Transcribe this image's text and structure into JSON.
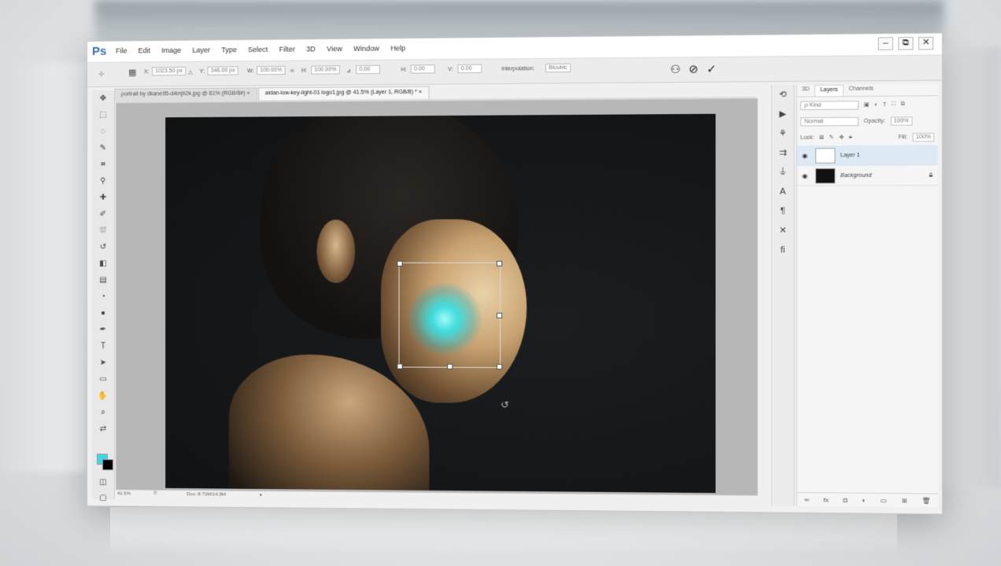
{
  "app": {
    "logo": "Ps"
  },
  "menu": [
    "File",
    "Edit",
    "Image",
    "Layer",
    "Type",
    "Select",
    "Filter",
    "3D",
    "View",
    "Window",
    "Help"
  ],
  "window_controls": [
    "–",
    "⧉",
    "✕"
  ],
  "options": {
    "x_label": "X:",
    "x_value": "1023.50 px",
    "y_label": "Y:",
    "y_value": "346.00 px",
    "w_label": "W:",
    "w_value": "100.00%",
    "h_label": "H:",
    "h_value": "100.00%",
    "angle_value": "0.00",
    "hskew_label": "H:",
    "hskew_value": "0.00",
    "vskew_label": "V:",
    "vskew_value": "0.00",
    "interp_label": "Interpolation:",
    "interp_value": "Bicubic"
  },
  "tabs": [
    {
      "label": "portrait by dkane95-d4mjh2k.jpg @ 81% (RGB/8#)",
      "close": "×"
    },
    {
      "label": "aidan-low-key-light-01 logo1.jpg @ 41.5% (Layer 1, RGB/8) *",
      "close": "×"
    }
  ],
  "status": {
    "zoom": "41.5%",
    "doc": "Doc: 8.73M/14.9M"
  },
  "layers_panel": {
    "tabs": [
      "3D",
      "Layers",
      "Channels"
    ],
    "kind": "ρ Kind",
    "blend_mode": "Normal",
    "opacity_label": "Opacity:",
    "opacity_value": "100%",
    "lock_label": "Lock:",
    "fill_label": "Fill:",
    "fill_value": "100%",
    "layers": [
      {
        "name": "Layer 1"
      },
      {
        "name": "Background"
      }
    ]
  },
  "colors": {
    "foreground": "#3fd6e6",
    "background": "#000000",
    "glow": "#28e6f0"
  }
}
